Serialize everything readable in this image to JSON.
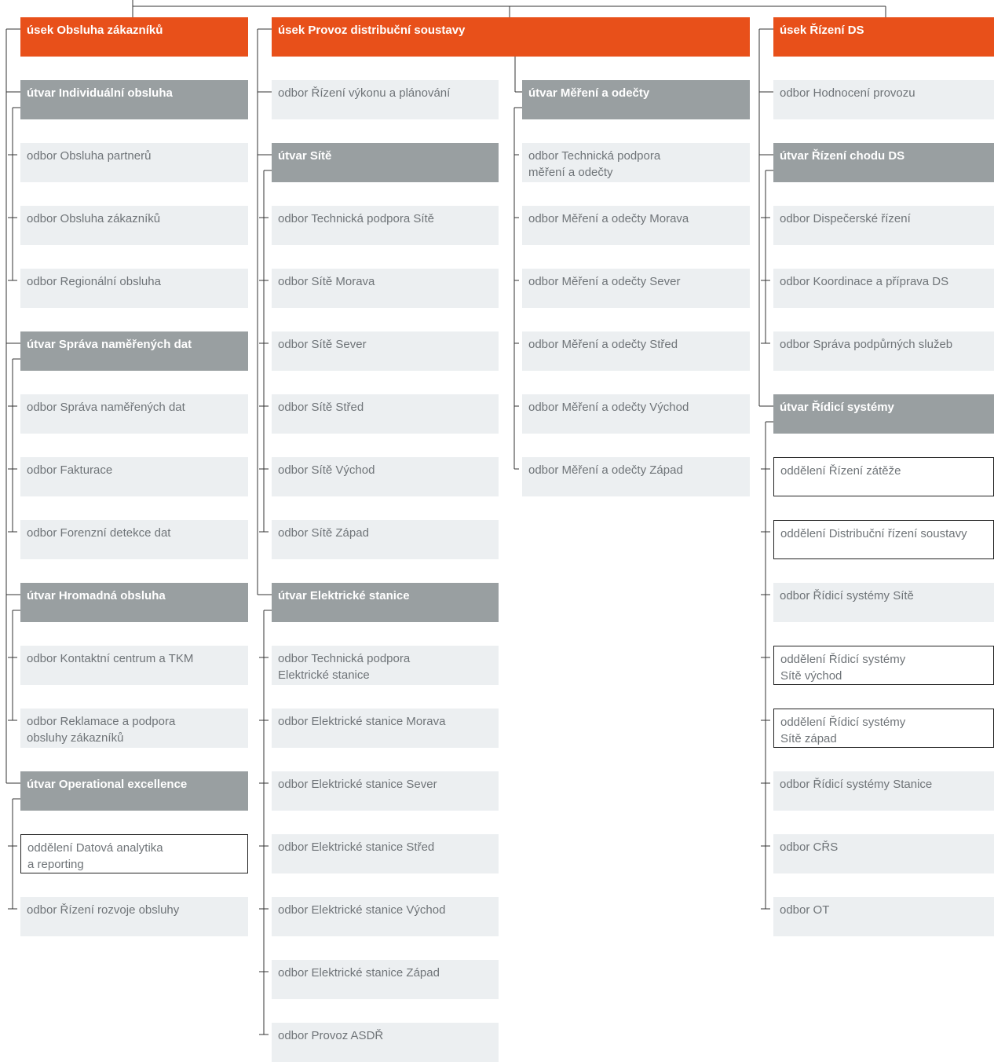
{
  "colors": {
    "usek": "#e8501a",
    "utvar": "#999fa1",
    "odbor": "#eceff1",
    "text_light": "#6f7478",
    "line": "#333333"
  },
  "columns": [
    {
      "usek": "úsek Obsluha zákazníků",
      "groups": [
        {
          "utvar": "útvar Individuální obsluha",
          "units": [
            {
              "kind": "odbor",
              "text": "odbor Obsluha partnerů"
            },
            {
              "kind": "odbor",
              "text": "odbor Obsluha zákazníků"
            },
            {
              "kind": "odbor",
              "text": "odbor Regionální obsluha"
            }
          ]
        },
        {
          "utvar": "útvar Správa naměřených dat",
          "units": [
            {
              "kind": "odbor",
              "text": "odbor Správa naměřených dat"
            },
            {
              "kind": "odbor",
              "text": "odbor Fakturace"
            },
            {
              "kind": "odbor",
              "text": "odbor Forenzní detekce dat"
            }
          ]
        },
        {
          "utvar": "útvar Hromadná obsluha",
          "units": [
            {
              "kind": "odbor",
              "text": "odbor Kontaktní centrum a TKM"
            },
            {
              "kind": "odbor",
              "text": "odbor Reklamace a podpora\nobsluhy zákazníků"
            }
          ]
        },
        {
          "utvar": "útvar Operational excellence",
          "units": [
            {
              "kind": "oddeleni",
              "text": "oddělení Datová analytika\na reporting"
            },
            {
              "kind": "odbor",
              "text": "odbor Řízení rozvoje obsluhy"
            }
          ]
        }
      ]
    },
    {
      "usek": "úsek Provoz distribuční soustavy",
      "direct": [
        {
          "kind": "odbor",
          "text": "odbor Řízení výkonu a plánování"
        }
      ],
      "groups": [
        {
          "utvar": "útvar Sítě",
          "units": [
            {
              "kind": "odbor",
              "text": "odbor Technická podpora Sítě"
            },
            {
              "kind": "odbor",
              "text": "odbor Sítě Morava"
            },
            {
              "kind": "odbor",
              "text": "odbor Sítě Sever"
            },
            {
              "kind": "odbor",
              "text": "odbor Sítě Střed"
            },
            {
              "kind": "odbor",
              "text": "odbor Sítě Východ"
            },
            {
              "kind": "odbor",
              "text": "odbor Sítě Západ"
            }
          ]
        },
        {
          "utvar": "útvar Elektrické stanice",
          "units": [
            {
              "kind": "odbor",
              "text": "odbor Technická podpora\nElektrické stanice"
            },
            {
              "kind": "odbor",
              "text": "odbor Elektrické stanice Morava"
            },
            {
              "kind": "odbor",
              "text": "odbor Elektrické stanice Sever"
            },
            {
              "kind": "odbor",
              "text": "odbor Elektrické stanice Střed"
            },
            {
              "kind": "odbor",
              "text": "odbor Elektrické stanice Východ"
            },
            {
              "kind": "odbor",
              "text": "odbor Elektrické stanice Západ"
            },
            {
              "kind": "odbor",
              "text": "odbor Provoz ASDŘ"
            }
          ]
        }
      ]
    },
    {
      "groups": [
        {
          "utvar": "útvar Měření a odečty",
          "units": [
            {
              "kind": "odbor",
              "text": "odbor Technická podpora\nměření a odečty"
            },
            {
              "kind": "odbor",
              "text": "odbor Měření a odečty Morava"
            },
            {
              "kind": "odbor",
              "text": "odbor Měření a odečty Sever"
            },
            {
              "kind": "odbor",
              "text": "odbor Měření a odečty Střed"
            },
            {
              "kind": "odbor",
              "text": "odbor Měření a odečty Východ"
            },
            {
              "kind": "odbor",
              "text": "odbor Měření a odečty Západ"
            }
          ]
        }
      ]
    },
    {
      "usek": "úsek Řízení DS",
      "direct": [
        {
          "kind": "odbor",
          "text": "odbor Hodnocení provozu"
        }
      ],
      "groups": [
        {
          "utvar": "útvar Řízení chodu DS",
          "units": [
            {
              "kind": "odbor",
              "text": "odbor Dispečerské řízení"
            },
            {
              "kind": "odbor",
              "text": "odbor Koordinace a příprava DS"
            },
            {
              "kind": "odbor",
              "text": "odbor Správa podpůrných služeb"
            }
          ]
        },
        {
          "utvar": "útvar Řídicí systémy",
          "units": [
            {
              "kind": "oddeleni",
              "text": "oddělení Řízení zátěže"
            },
            {
              "kind": "oddeleni",
              "text": "oddělení Distribuční řízení soustavy"
            },
            {
              "kind": "odbor",
              "text": "odbor Řídicí systémy Sítě"
            },
            {
              "kind": "oddeleni",
              "text": "oddělení Řídicí systémy\nSítě východ"
            },
            {
              "kind": "oddeleni",
              "text": "oddělení Řídicí systémy\nSítě západ"
            },
            {
              "kind": "odbor",
              "text": "odbor Řídicí systémy Stanice"
            },
            {
              "kind": "odbor",
              "text": "odbor CŘS"
            },
            {
              "kind": "odbor",
              "text": "odbor OT"
            }
          ]
        }
      ]
    }
  ]
}
